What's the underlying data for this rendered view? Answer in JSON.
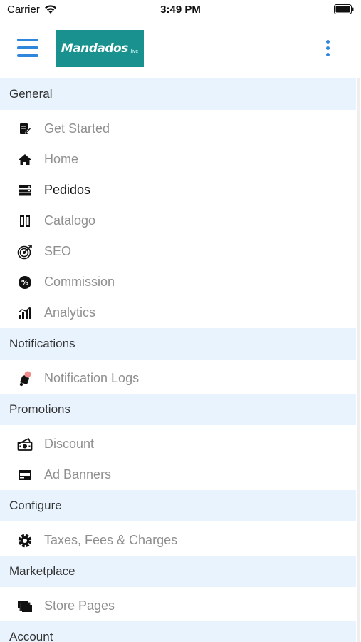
{
  "status_bar": {
    "carrier": "Carrier",
    "time": "3:49 PM",
    "wifi_icon": "wifi-icon",
    "battery_icon": "battery-icon"
  },
  "header": {
    "logo_text": "Mandados",
    "logo_sub": ".live",
    "menu_icon": "hamburger-icon",
    "more_icon": "vertical-dots-icon",
    "accent_color": "#2f86dd",
    "logo_color": "#19928f"
  },
  "sections": [
    {
      "title": "General",
      "items": [
        {
          "label": "Get Started",
          "icon": "edit-document-icon",
          "active": false
        },
        {
          "label": "Home",
          "icon": "home-icon",
          "active": false
        },
        {
          "label": "Pedidos",
          "icon": "orders-list-icon",
          "active": true
        },
        {
          "label": "Catalogo",
          "icon": "catalog-book-icon",
          "active": false
        },
        {
          "label": "SEO",
          "icon": "target-icon",
          "active": false
        },
        {
          "label": "Commission",
          "icon": "percent-badge-icon",
          "active": false
        },
        {
          "label": "Analytics",
          "icon": "analytics-chart-icon",
          "active": false
        }
      ]
    },
    {
      "title": "Notifications",
      "items": [
        {
          "label": "Notification Logs",
          "icon": "notification-bell-icon",
          "active": false
        }
      ]
    },
    {
      "title": "Promotions",
      "items": [
        {
          "label": "Discount",
          "icon": "discount-money-icon",
          "active": false
        },
        {
          "label": "Ad Banners",
          "icon": "ad-banner-icon",
          "active": false
        }
      ]
    },
    {
      "title": "Configure",
      "items": [
        {
          "label": "Taxes, Fees & Charges",
          "icon": "tax-gear-icon",
          "active": false
        }
      ]
    },
    {
      "title": "Marketplace",
      "items": [
        {
          "label": "Store Pages",
          "icon": "store-pages-icon",
          "active": false
        }
      ]
    },
    {
      "title": "Account",
      "items": []
    }
  ]
}
